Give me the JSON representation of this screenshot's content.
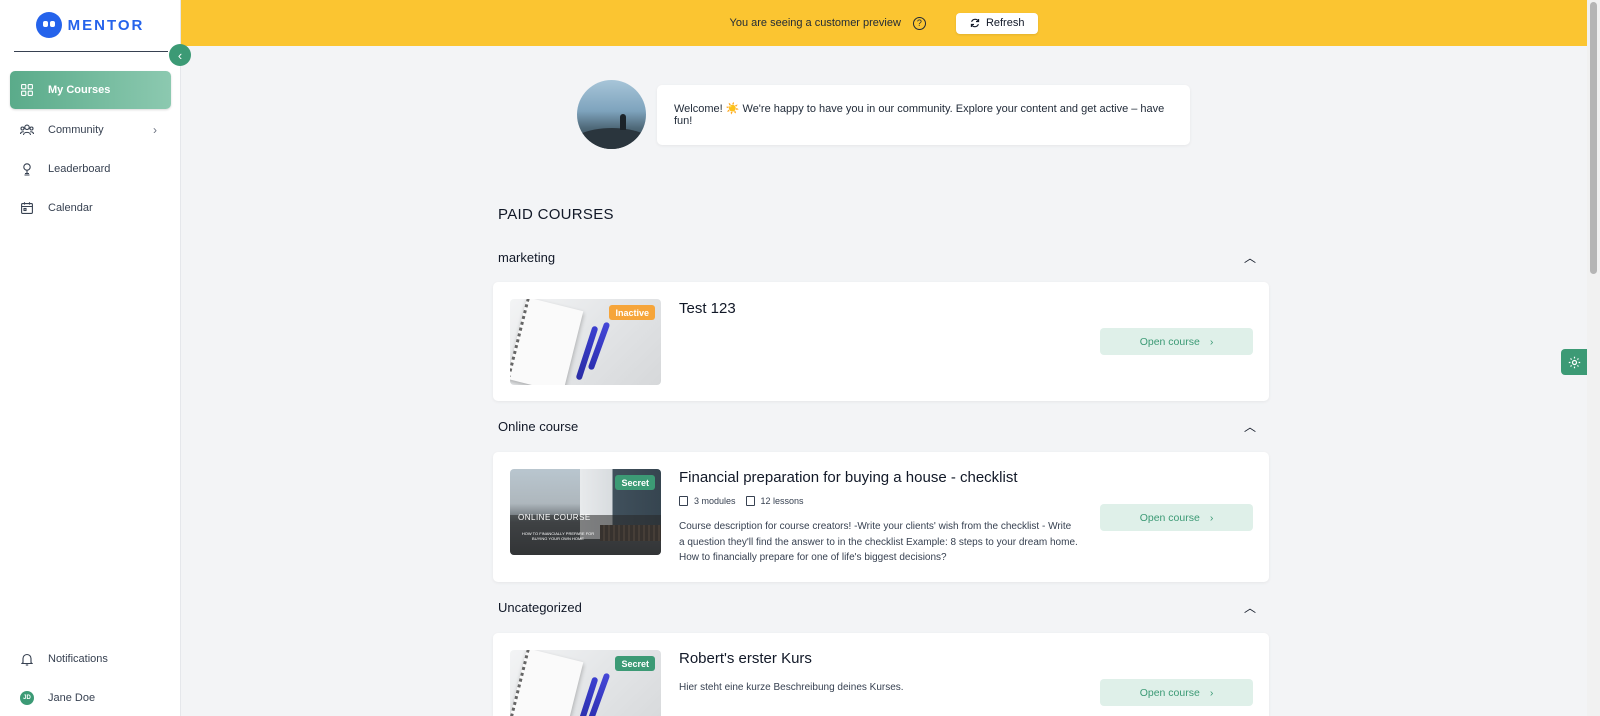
{
  "app": {
    "logo_text": "MENTOR"
  },
  "sidebar": {
    "items": [
      {
        "label": "My Courses",
        "icon": "grid-icon"
      },
      {
        "label": "Community",
        "icon": "community-icon"
      },
      {
        "label": "Leaderboard",
        "icon": "trophy-icon"
      },
      {
        "label": "Calendar",
        "icon": "calendar-icon"
      }
    ],
    "bottom": [
      {
        "label": "Notifications",
        "icon": "bell-icon"
      },
      {
        "label": "Jane Doe",
        "initials": "JD"
      }
    ]
  },
  "banner": {
    "text": "You are seeing a customer preview",
    "refresh_label": "Refresh",
    "background": "#fbc531"
  },
  "welcome": {
    "message": "Welcome! ☀️ We're happy to have you in our community. Explore your content and get active – have fun!"
  },
  "main": {
    "section_title": "PAID COURSES",
    "categories": [
      {
        "name": "marketing",
        "courses": [
          {
            "title": "Test 123",
            "badge": "Inactive",
            "button": "Open course"
          }
        ]
      },
      {
        "name": "Online course",
        "courses": [
          {
            "title": "Financial preparation for buying a house - checklist",
            "badge": "Secret",
            "modules": "3 modules",
            "lessons": "12 lessons",
            "description": "Course description for course creators! -Write your clients' wish from the checklist - Write a question they'll find the answer to in the checklist Example: 8 steps to your dream home. How to financially prepare for one of life's biggest decisions?",
            "thumb_title": "ONLINE COURSE",
            "thumb_subtitle": "HOW TO FINANCIALLY PREPARE FOR BUYING YOUR OWN HOME",
            "button": "Open course"
          }
        ]
      },
      {
        "name": "Uncategorized",
        "courses": [
          {
            "title": "Robert's erster Kurs",
            "badge": "Secret",
            "description": "Hier steht eine kurze Beschreibung deines Kurses.",
            "button": "Open course"
          }
        ]
      }
    ]
  },
  "colors": {
    "accent": "#3c9a75",
    "inactive": "#f6a53a",
    "brand": "#2563eb"
  }
}
